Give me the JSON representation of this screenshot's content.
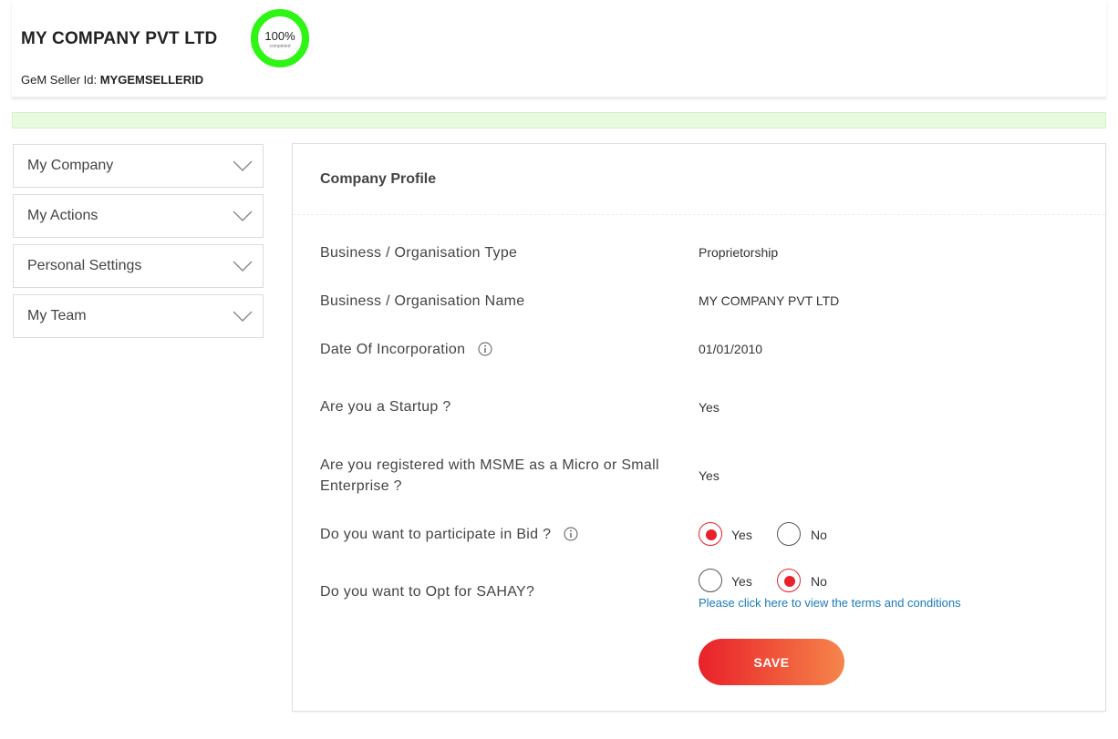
{
  "header": {
    "company_name": "MY COMPANY PVT LTD",
    "seller_id_label": "GeM Seller Id:",
    "seller_id_value": "MYGEMSELLERID",
    "progress_percent": 100,
    "progress_text": "100%",
    "progress_sub": "completed",
    "progress_color": "#2ef513"
  },
  "sidebar": {
    "items": [
      {
        "label": "My Company"
      },
      {
        "label": "My Actions"
      },
      {
        "label": "Personal Settings"
      },
      {
        "label": "My Team"
      }
    ]
  },
  "panel": {
    "title": "Company Profile",
    "rows": {
      "org_type": {
        "label": "Business / Organisation Type",
        "value": "Proprietorship"
      },
      "org_name": {
        "label": "Business / Organisation Name",
        "value": "MY COMPANY PVT LTD"
      },
      "doi": {
        "label": "Date Of Incorporation",
        "value": "01/01/2010"
      },
      "startup": {
        "label": "Are you a Startup ?",
        "value": "Yes"
      },
      "msme": {
        "label": "Are you registered with MSME as a Micro or Small Enterprise ?",
        "value": "Yes"
      },
      "bid": {
        "label": "Do you want to participate in Bid ?",
        "yes": "Yes",
        "no": "No",
        "selected": "Yes"
      },
      "sahay": {
        "label": "Do you want to Opt for SAHAY?",
        "yes": "Yes",
        "no": "No",
        "selected": "No"
      }
    },
    "terms_link": "Please click here to view the terms and conditions",
    "save_label": "SAVE"
  },
  "colors": {
    "accent_red": "#e8212b",
    "save_gradient_end": "#f5864b",
    "link_blue": "#1a7ab8",
    "status_strip": "#e6fbe0"
  }
}
